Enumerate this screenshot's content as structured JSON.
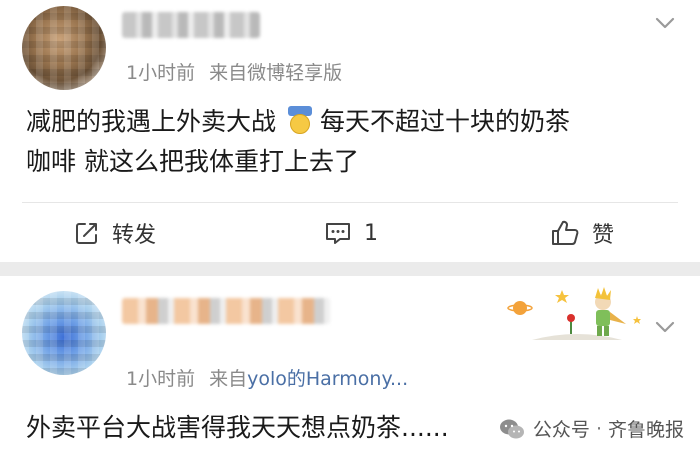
{
  "posts": [
    {
      "time": "1小时前",
      "source_prefix": "来自",
      "source": "微博轻享版",
      "text_line1_a": "减肥的我遇上外卖大战",
      "text_line1_b": "每天不超过十块的奶茶",
      "text_line2": "咖啡 就这么把我体重打上去了",
      "emoji_icon": "sweat-smile-emoji",
      "actions": {
        "repost_label": "转发",
        "comment_count": "1",
        "like_label": "赞"
      }
    },
    {
      "time": "1小时前",
      "source_prefix": "来自",
      "source": "yolo的Harmony...",
      "text": "外卖平台大战害得我天天想点奶茶......"
    }
  ],
  "watermark": {
    "label": "公众号",
    "separator": "·",
    "account": "齐鲁晚报"
  },
  "colors": {
    "link": "#4a6fa5",
    "meta": "#8a8a8a",
    "background": "#ebebeb"
  }
}
